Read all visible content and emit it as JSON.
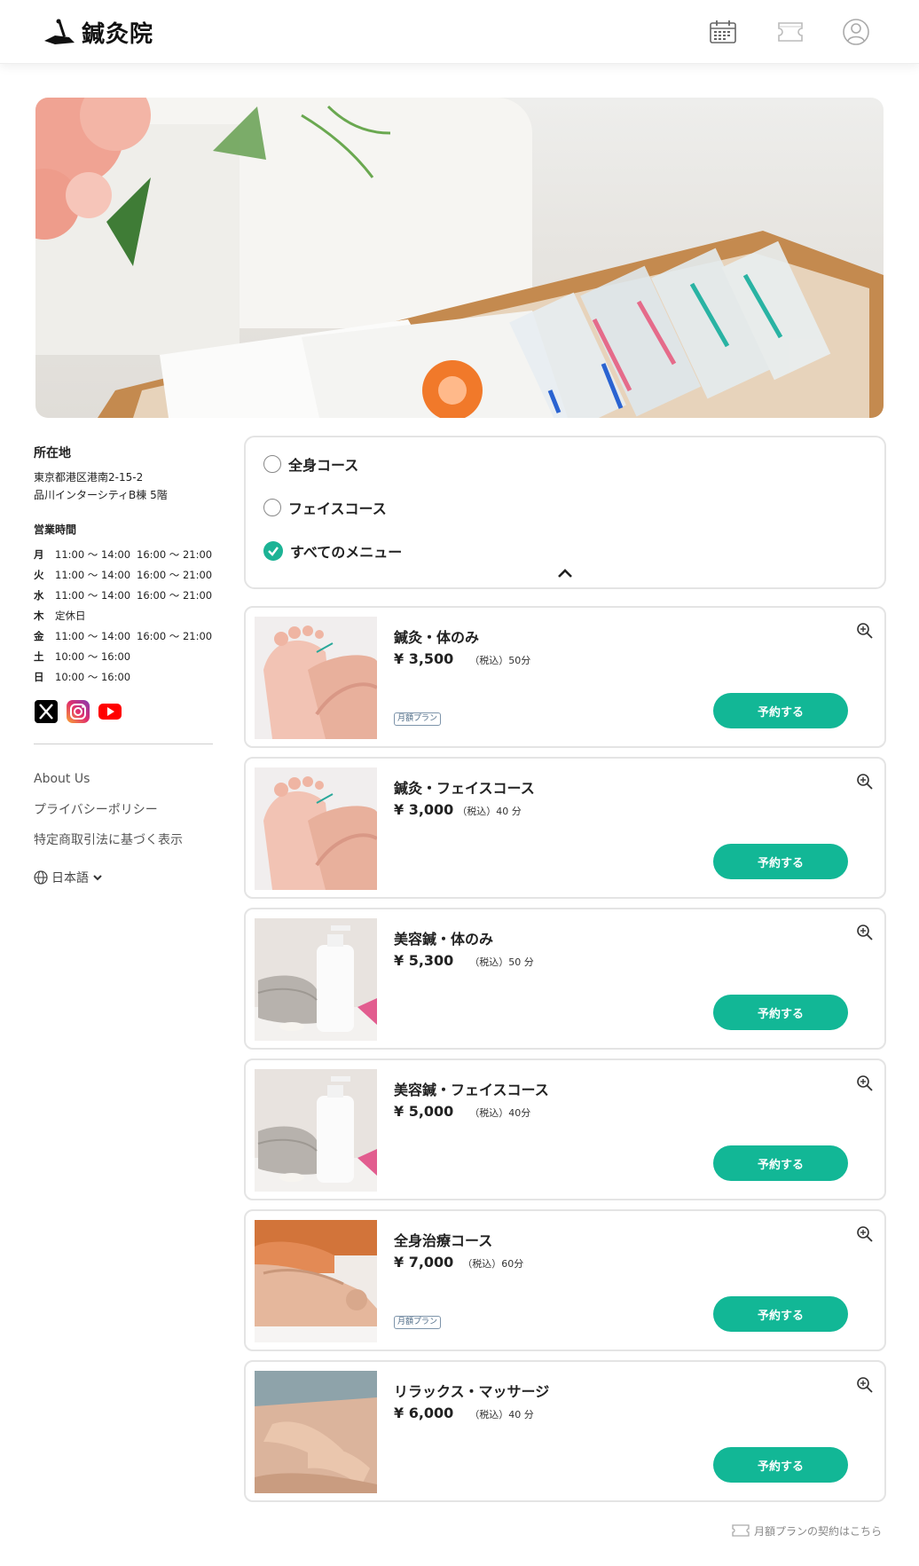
{
  "header": {
    "logo_text": "鍼灸院",
    "icons": [
      "calendar-icon",
      "ticket-icon",
      "user-icon"
    ]
  },
  "sidebar": {
    "location_title": "所在地",
    "address_line1": "東京都港区港南2-15-2",
    "address_line2": "品川インターシティB棟 5階",
    "hours_title": "営業時間",
    "hours": [
      {
        "day": "月",
        "t1": "11:00 ～ 14:00",
        "t2": "16:00 ～ 21:00"
      },
      {
        "day": "火",
        "t1": "11:00 ～ 14:00",
        "t2": "16:00 ～ 21:00"
      },
      {
        "day": "水",
        "t1": "11:00 ～ 14:00",
        "t2": "16:00 ～ 21:00"
      },
      {
        "day": "木",
        "t1": "定休日",
        "t2": ""
      },
      {
        "day": "金",
        "t1": "11:00 ～ 14:00",
        "t2": "16:00 ～ 21:00"
      },
      {
        "day": "土",
        "t1": "10:00 ～ 16:00",
        "t2": ""
      },
      {
        "day": "日",
        "t1": "10:00 ～ 16:00",
        "t2": ""
      }
    ],
    "links": [
      "About Us",
      "プライバシーポリシー",
      "特定商取引法に基づく表示"
    ],
    "language": "日本語"
  },
  "filter": {
    "options": [
      {
        "label": "全身コース",
        "selected": false
      },
      {
        "label": "フェイスコース",
        "selected": false
      },
      {
        "label": "すべてのメニュー",
        "selected": true
      }
    ]
  },
  "menu": [
    {
      "title": "鍼灸・体のみ",
      "price": "¥ 3,500",
      "note": "（税込）50分",
      "badge": "月額プラン",
      "button": "予約する"
    },
    {
      "title": "鍼灸・フェイスコース",
      "price": "¥ 3,000",
      "note": "（税込）40 分",
      "badge": "",
      "button": "予約する"
    },
    {
      "title": "美容鍼・体のみ",
      "price": "¥ 5,300",
      "note": "（税込）50 分",
      "badge": "",
      "button": "予約する"
    },
    {
      "title": "美容鍼・フェイスコース",
      "price": "¥ 5,000",
      "note": "（税込）40分",
      "badge": "",
      "button": "予約する"
    },
    {
      "title": "全身治療コース",
      "price": "¥ 7,000",
      "note": "（税込）60分",
      "badge": "月額プラン",
      "button": "予約する"
    },
    {
      "title": "リラックス・マッサージ",
      "price": "¥ 6,000",
      "note": "（税込）40 分",
      "badge": "",
      "button": "予約する"
    }
  ],
  "footer": {
    "monthly_link": "月額プランの契約はこちら"
  },
  "colors": {
    "accent": "#12b796",
    "border": "#e4e4e4"
  }
}
